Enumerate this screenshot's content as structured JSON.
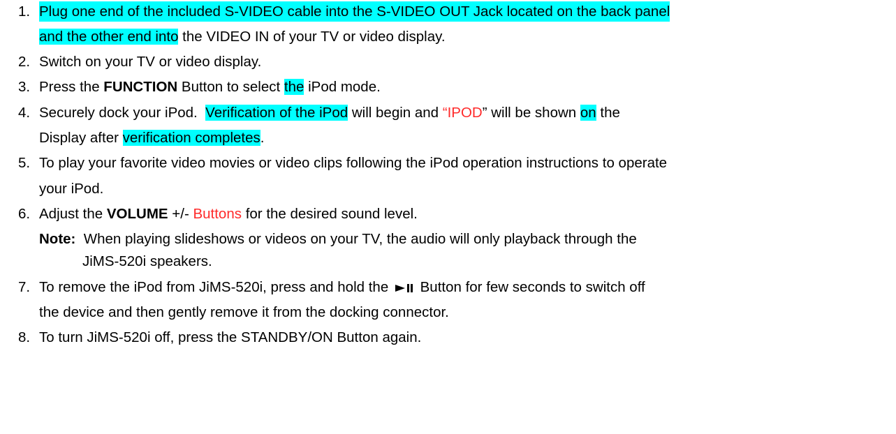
{
  "steps": [
    {
      "number": "1.",
      "line1": "Plug one end of the included S-VIDEO cable into the S-VIDEO OUT Jack located on the back panel",
      "line2_hl": "and the other end into",
      "line2_rest": " the VIDEO IN of your TV or video display."
    },
    {
      "number": "2.",
      "text": "Switch on your TV or video display."
    },
    {
      "number": "3.",
      "pre": "Press the ",
      "bold": "FUNCTION",
      "mid": " Button to select ",
      "hl": "the",
      "post": " iPod mode."
    },
    {
      "number": "4.",
      "pre": "Securely dock your iPod.  ",
      "hl1": "Verification of the iPod",
      "mid1": " will begin and ",
      "red": "“IPOD",
      "mid2": "” will be shown ",
      "hl2": "on",
      "post1": " the",
      "line2_pre": "Display after ",
      "line2_hl": "verification completes",
      "line2_post": "."
    },
    {
      "number": "5.",
      "line1": "To play your favorite video movies or video clips following the iPod operation instructions to operate",
      "line2": "your iPod."
    },
    {
      "number": "6.",
      "pre": "Adjust the ",
      "bold": "VOLUME",
      "mid": " +/- ",
      "red": "Buttons",
      "post": " for the desired sound level.",
      "note_label": "Note:",
      "note_line1": "  When playing slideshows or videos on your TV, the audio will only playback through the",
      "note_line2": "JiMS-520i speakers."
    },
    {
      "number": "7.",
      "pre": "To remove the iPod from JiMS-520i, press and hold the ",
      "icon": "play-pause-icon",
      "post": " Button for few seconds to switch off",
      "line2": "the device and then gently remove it from the docking connector."
    },
    {
      "number": "8.",
      "text": "To turn JiMS-520i off, press the STANDBY/ON Button again."
    }
  ],
  "colors": {
    "highlight": "#00ffff",
    "red_text": "#ff2a2a"
  }
}
